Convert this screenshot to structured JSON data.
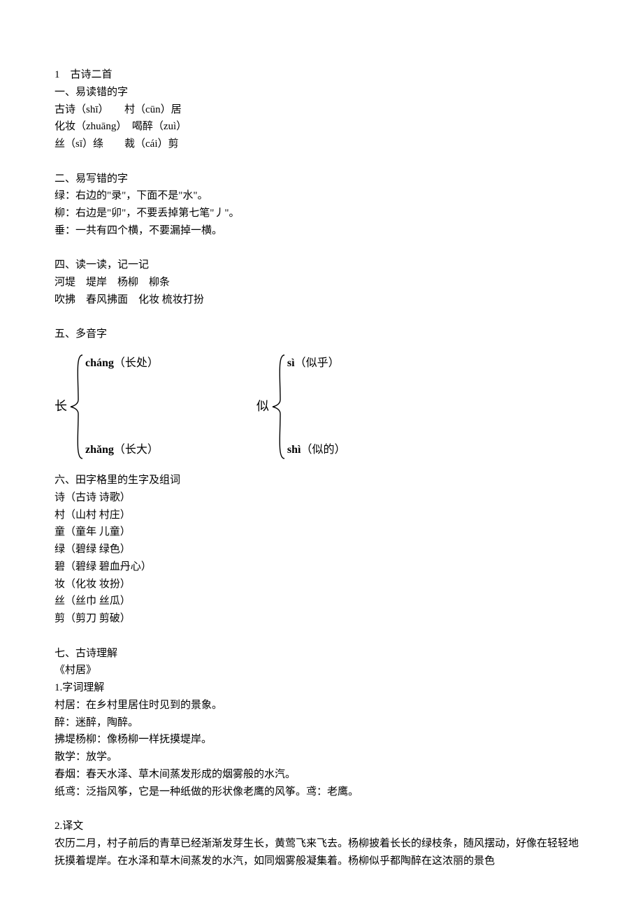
{
  "title_line": "1　古诗二首",
  "sec1": {
    "heading": "一、易读错的字",
    "lines": [
      "古诗（shī）　　村（cūn）居",
      "化妆（zhuāng）　喝醉（zuì）",
      "丝（sī）绦　　裁（cái）剪"
    ]
  },
  "sec2": {
    "heading": "二、易写错的字",
    "lines": [
      "绿：右边的\"录\"，下面不是\"水\"。",
      "柳：右边是\"卯\"，不要丢掉第七笔\"丿\"。",
      "垂：一共有四个横，不要漏掉一横。"
    ]
  },
  "sec4": {
    "heading": "四、读一读，记一记",
    "lines": [
      "河堤　堤岸　杨柳　柳条",
      "吹拂　春风拂面　化妆 梳妆打扮"
    ]
  },
  "sec5": {
    "heading": "五、多音字",
    "chars": [
      {
        "main": "长",
        "readings": [
          {
            "pinyin": "cháng",
            "word": "（长处）"
          },
          {
            "pinyin": "zhǎng",
            "word": "（长大）"
          }
        ]
      },
      {
        "main": "似",
        "readings": [
          {
            "pinyin": "sì",
            "word": "（似乎）"
          },
          {
            "pinyin": "shì",
            "word": "（似的）"
          }
        ]
      }
    ]
  },
  "sec6": {
    "heading": "六、田字格里的生字及组词",
    "lines": [
      "诗（古诗 诗歌）",
      "村（山村 村庄）",
      "童（童年 儿童）",
      "绿（碧绿 绿色）",
      "碧（碧绿 碧血丹心）",
      "妆（化妆 妆扮）",
      "丝（丝巾 丝瓜）",
      "剪（剪刀 剪破）"
    ]
  },
  "sec7": {
    "heading": "七、古诗理解",
    "poem_title": "《村居》",
    "sub1_heading": "1.字词理解",
    "sub1_lines": [
      "村居：在乡村里居住时见到的景象。",
      "醉：迷醉，陶醉。",
      "拂堤杨柳：像杨柳一样抚摸堤岸。",
      "散学：放学。",
      "春烟：春天水泽、草木间蒸发形成的烟雾般的水汽。",
      "纸鸢：泛指风筝，它是一种纸做的形状像老鹰的风筝。鸢：老鹰。"
    ],
    "sub2_heading": "2.译文",
    "sub2_lines": [
      "农历二月，村子前后的青草已经渐渐发芽生长，黄莺飞来飞去。杨柳披着长长的绿枝条，随风摆动，好像在轻轻地抚摸着堤岸。在水泽和草木间蒸发的水汽，如同烟雾般凝集着。杨柳似乎都陶醉在这浓丽的景色"
    ]
  }
}
